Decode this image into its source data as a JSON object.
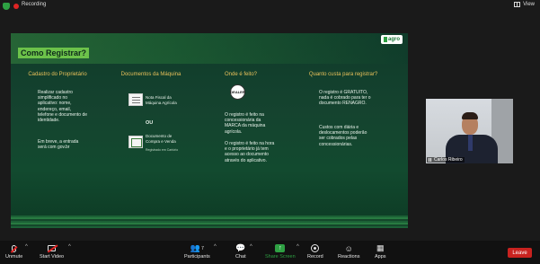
{
  "topbar": {
    "recording_label": "Recording",
    "view_label": "View"
  },
  "slide": {
    "title": "Como Registrar?",
    "logo_text": "agro",
    "columns": [
      {
        "heading": "Cadastro do Proprietário",
        "text1": "Realizar cadastro simplificado no aplicativo: nome, endereço, email, telefone e documento de identidade.",
        "text2": "Em breve, a entrada será com gov.br"
      },
      {
        "heading": "Documentos da Máquina",
        "doc1": "Nota Fiscal da Máquina Agrícola",
        "or": "OU",
        "doc2": "Documento de Compra e Venda",
        "doc2_sub": "Registrado em Cartório"
      },
      {
        "heading": "Onde é feito?",
        "dealer_badge": "DEALER",
        "text1": "O registro é feito na concessionária da MARCA da máquina agrícola.",
        "text2": "O registro é feito na hora e o proprietário já tem acesso ao documento através do aplicativo."
      },
      {
        "heading": "Quanto custa para registrar?",
        "text1": "O registro é GRATUITO, nada é cobrado para ter o documento RENAGRO.",
        "text2": "Custos com diária e deslocamentos poderão ser cobrados pelas concessionárias."
      }
    ]
  },
  "participant": {
    "name": "Carlos Ribeiro"
  },
  "toolbar": {
    "unmute": "Unmute",
    "start_video": "Start Video",
    "participants": "Participants",
    "participants_count": "7",
    "chat": "Chat",
    "share_screen": "Share Screen",
    "record": "Record",
    "reactions": "Reactions",
    "apps": "Apps",
    "leave": "Leave"
  }
}
